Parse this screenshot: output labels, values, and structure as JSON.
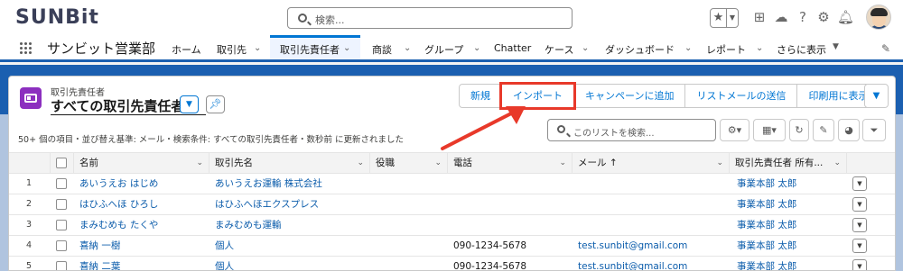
{
  "header": {
    "logo": "SUNBit",
    "search_placeholder": "検索...",
    "utility_icons": [
      "favorite-star-icon",
      "add-icon",
      "cloud-icon",
      "help-icon",
      "setup-gear-icon",
      "notification-bell-icon",
      "user-avatar"
    ]
  },
  "nav": {
    "app_name": "サンビット営業部",
    "items": [
      {
        "label": "ホーム",
        "dropdown": false
      },
      {
        "label": "取引先",
        "dropdown": true
      },
      {
        "label": "取引先責任者",
        "dropdown": true,
        "active": true
      },
      {
        "label": "商談",
        "dropdown": true
      },
      {
        "label": "グループ",
        "dropdown": true
      },
      {
        "label": "Chatter",
        "dropdown": false
      },
      {
        "label": "ケース",
        "dropdown": true
      },
      {
        "label": "ダッシュボード",
        "dropdown": true
      },
      {
        "label": "レポート",
        "dropdown": true
      },
      {
        "label": "さらに表示",
        "dropdown": true
      }
    ]
  },
  "list": {
    "object_label": "取引先責任者",
    "title": "すべての取引先責任者",
    "info": "50+ 個の項目・並び替え基準: メール・検索条件: すべての取引先責任者・数秒前 に更新されました",
    "buttons": {
      "new": "新規",
      "import": "インポート",
      "add_campaign": "キャンペーンに追加",
      "send_list_email": "リストメールの送信",
      "print_view": "印刷用に表示"
    },
    "search_placeholder": "このリストを検索..."
  },
  "table": {
    "columns": [
      "名前",
      "取引先名",
      "役職",
      "電話",
      "メール ↑",
      "取引先責任者 所有..."
    ],
    "rows": [
      {
        "num": "1",
        "name": "あいうえお はじめ",
        "account": "あいうえお運輸 株式会社",
        "title": "",
        "phone": "",
        "email": "",
        "owner": "事業本部 太郎"
      },
      {
        "num": "2",
        "name": "はひふへほ ひろし",
        "account": "はひふへほエクスプレス",
        "title": "",
        "phone": "",
        "email": "",
        "owner": "事業本部 太郎"
      },
      {
        "num": "3",
        "name": "まみむめも たくや",
        "account": "まみむめも運輸",
        "title": "",
        "phone": "",
        "email": "",
        "owner": "事業本部 太郎"
      },
      {
        "num": "4",
        "name": "喜納 一樹",
        "account": "個人",
        "title": "",
        "phone": "090-1234-5678",
        "email": "test.sunbit@gmail.com",
        "owner": "事業本部 太郎"
      },
      {
        "num": "5",
        "name": "喜納 二葉",
        "account": "個人",
        "title": "",
        "phone": "090-1234-5678",
        "email": "test.sunbit@gmail.com",
        "owner": "事業本部 太郎"
      }
    ]
  },
  "colors": {
    "brand_blue": "#1b5fb0",
    "link_blue": "#0b5cab",
    "highlight_red": "#e8392a",
    "object_icon_purple": "#8c2fbf"
  }
}
